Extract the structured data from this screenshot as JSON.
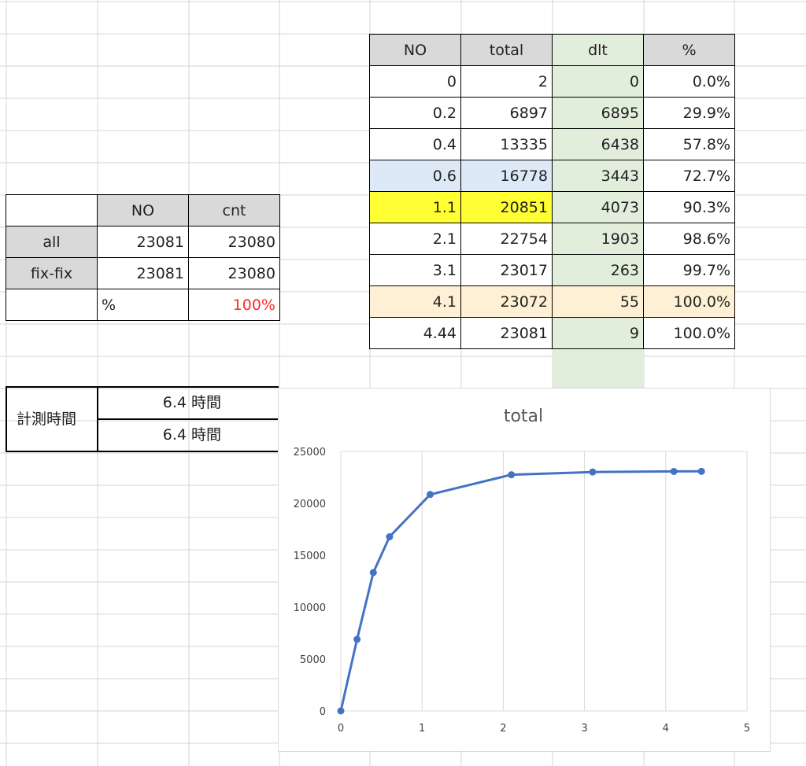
{
  "main_table": {
    "headers": [
      "NO",
      "total",
      "dlt",
      "%"
    ],
    "rows": [
      [
        "0",
        "2",
        "0",
        "0.0%"
      ],
      [
        "0.2",
        "6897",
        "6895",
        "29.9%"
      ],
      [
        "0.4",
        "13335",
        "6438",
        "57.8%"
      ],
      [
        "0.6",
        "16778",
        "3443",
        "72.7%"
      ],
      [
        "1.1",
        "20851",
        "4073",
        "90.3%"
      ],
      [
        "2.1",
        "22754",
        "1903",
        "98.6%"
      ],
      [
        "3.1",
        "23017",
        "263",
        "99.7%"
      ],
      [
        "4.1",
        "23072",
        "55",
        "100.0%"
      ],
      [
        "4.44",
        "23081",
        "9",
        "100.0%"
      ]
    ],
    "highlight_colors": {
      "dlt_column": "#e2eedc",
      "row_0_6": "#dde9f6",
      "row_1_1": "#ffff33",
      "row_4_1": "#fdf0d5"
    }
  },
  "summary_table": {
    "headers": [
      "",
      "NO",
      "cnt"
    ],
    "rows": [
      [
        "all",
        "23081",
        "23080"
      ],
      [
        "fix-fix",
        "23081",
        "23080"
      ],
      [
        "",
        "%",
        "100%"
      ]
    ],
    "percent_color": "#ff2a2a"
  },
  "measure_block": {
    "label": "計測時間",
    "rows": [
      {
        "value": "6.4",
        "unit": "時間"
      },
      {
        "value": "6.4",
        "unit": "時間"
      }
    ]
  },
  "chart_data": {
    "type": "scatter",
    "title": "total",
    "xlabel": "",
    "ylabel": "",
    "xlim": [
      0,
      5
    ],
    "ylim": [
      0,
      25000
    ],
    "x_ticks": [
      0,
      1,
      2,
      3,
      4,
      5
    ],
    "y_ticks": [
      0,
      5000,
      10000,
      15000,
      20000,
      25000
    ],
    "grid": "vertical",
    "series": [
      {
        "color": "#4472c4",
        "points": [
          {
            "x": 0,
            "y": 2
          },
          {
            "x": 0.2,
            "y": 6897
          },
          {
            "x": 0.4,
            "y": 13335
          },
          {
            "x": 0.6,
            "y": 16778
          },
          {
            "x": 1.1,
            "y": 20851
          },
          {
            "x": 2.1,
            "y": 22754
          },
          {
            "x": 3.1,
            "y": 23017
          },
          {
            "x": 4.1,
            "y": 23072
          },
          {
            "x": 4.44,
            "y": 23081
          }
        ]
      }
    ]
  }
}
